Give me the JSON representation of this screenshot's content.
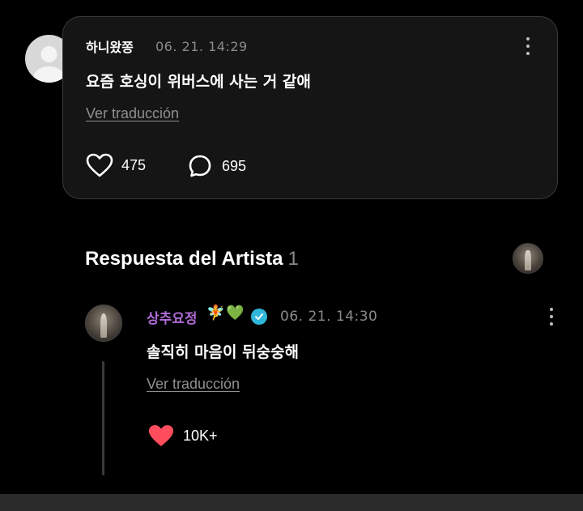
{
  "post": {
    "username": "하니왔쫑",
    "timestamp": "06. 21. 14:29",
    "text": "요즘 호싱이 위버스에 사는 거 같애",
    "translate_label": "Ver traducción",
    "likes": "475",
    "comments": "695",
    "icons": {
      "avatar": "default-avatar-icon",
      "more": "kebab-menu-icon",
      "like": "heart-outline-icon",
      "comment": "comment-bubble-icon"
    }
  },
  "artist_section": {
    "title": "Respuesta del Artista",
    "count": "1"
  },
  "reply": {
    "username": "상추요정",
    "emoji_1": "🧚",
    "emoji_2": "💚",
    "timestamp": "06. 21. 14:30",
    "text": "솔직히 마음이 뒤숭숭해",
    "translate_label": "Ver traducción",
    "likes": "10K+",
    "icons": {
      "verified": "verified-badge-icon",
      "more": "kebab-menu-icon",
      "like": "heart-filled-icon"
    }
  },
  "colors": {
    "background": "#000000",
    "card": "#151515",
    "artist_name": "#b06bd6",
    "verified": "#2fb6d9",
    "liked_heart": "#ff4d5e",
    "muted": "#8a8a8a"
  }
}
